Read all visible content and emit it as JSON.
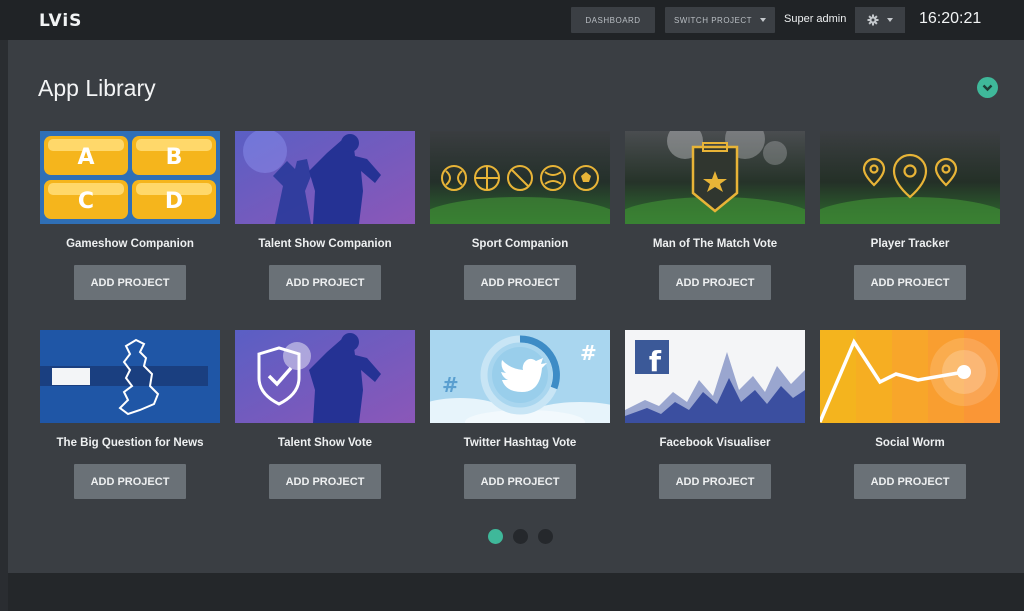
{
  "header": {
    "logo": "LViS",
    "dashboard_label": "DASHBOARD",
    "switch_project_label": "SWITCH PROJECT",
    "user": "Super admin",
    "clock": "16:20:21",
    "icons": {
      "settings": "gear-icon",
      "dropdown": "chevron-down-icon"
    }
  },
  "page": {
    "title": "App Library",
    "collapse_icon": "chevron-down-icon",
    "accent": "#3fb89a"
  },
  "apps": [
    {
      "title": "Gameshow Companion",
      "button": "ADD PROJECT"
    },
    {
      "title": "Talent Show Companion",
      "button": "ADD PROJECT"
    },
    {
      "title": "Sport Companion",
      "button": "ADD PROJECT"
    },
    {
      "title": "Man of The Match Vote",
      "button": "ADD PROJECT"
    },
    {
      "title": "Player Tracker",
      "button": "ADD PROJECT"
    },
    {
      "title": "The Big Question for News",
      "button": "ADD PROJECT"
    },
    {
      "title": "Talent Show Vote",
      "button": "ADD PROJECT"
    },
    {
      "title": "Twitter Hashtag Vote",
      "button": "ADD PROJECT"
    },
    {
      "title": "Facebook Visualiser",
      "button": "ADD PROJECT"
    },
    {
      "title": "Social Worm",
      "button": "ADD PROJECT"
    }
  ],
  "thumbnails": {
    "gameshow": {
      "tiles": [
        "A",
        "B",
        "C",
        "D"
      ]
    },
    "twitter": {
      "hashtag": "#"
    },
    "facebook": {
      "logo": "f"
    }
  },
  "pagination": {
    "pages": 3,
    "current": 1
  }
}
